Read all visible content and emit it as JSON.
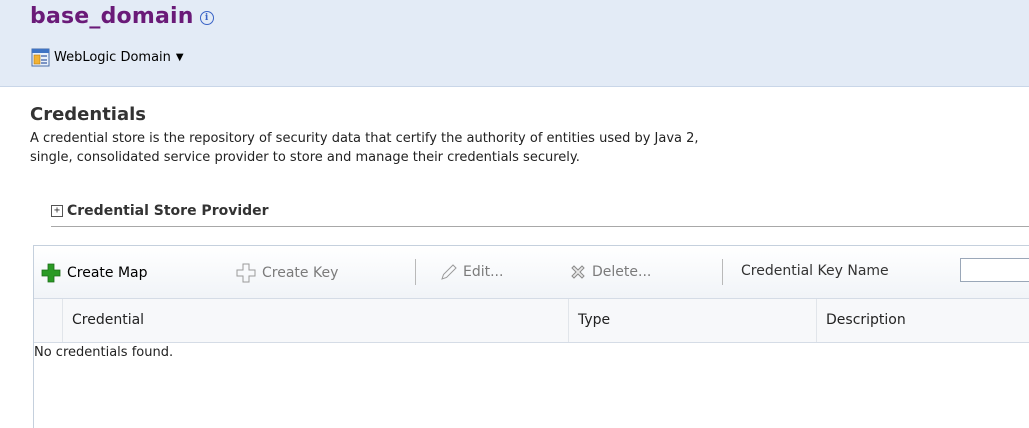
{
  "header": {
    "title": "base_domain",
    "info_icon_text": "i",
    "domain_menu_label": "WebLogic Domain"
  },
  "page": {
    "title": "Credentials",
    "description_line1": "A credential store is the repository of security data that certify the authority of entities used by Java 2,",
    "description_line2": "single, consolidated service provider to store and manage their credentials securely."
  },
  "provider": {
    "label": "Credential Store Provider",
    "expand_symbol": "+"
  },
  "toolbar": {
    "create_map_label": "Create Map",
    "create_key_label": "Create Key",
    "edit_label": "Edit...",
    "delete_label": "Delete...",
    "search_label": "Credential Key Name",
    "search_value": ""
  },
  "table": {
    "columns": [
      "Credential",
      "Type",
      "Description"
    ],
    "empty_message": "No credentials found."
  },
  "colors": {
    "header_bg": "#e3ebf6",
    "title_color": "#6a1a78",
    "create_icon_green": "#2a9a25"
  }
}
